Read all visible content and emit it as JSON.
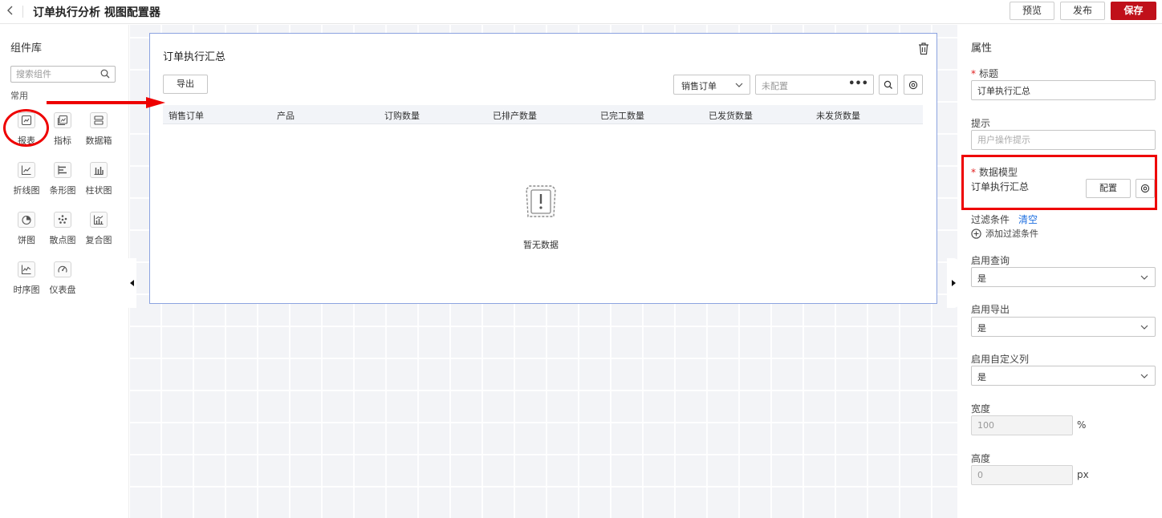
{
  "header": {
    "back_icon": "chevron-left-icon",
    "title": "订单执行分析 视图配置器",
    "buttons": {
      "preview": "预览",
      "publish": "发布",
      "save": "保存"
    },
    "colors": {
      "save_bg": "#c0101a"
    }
  },
  "library": {
    "title": "组件库",
    "search_placeholder": "搜索组件",
    "group_label": "常用",
    "components": [
      {
        "label": "报表",
        "icon": "report-icon"
      },
      {
        "label": "指标",
        "icon": "indicator-icon"
      },
      {
        "label": "数据箱",
        "icon": "databox-icon"
      },
      {
        "label": "折线图",
        "icon": "line-chart-icon"
      },
      {
        "label": "条形图",
        "icon": "bar-horizontal-icon"
      },
      {
        "label": "柱状图",
        "icon": "column-chart-icon"
      },
      {
        "label": "饼图",
        "icon": "pie-chart-icon"
      },
      {
        "label": "散点图",
        "icon": "scatter-icon"
      },
      {
        "label": "复合图",
        "icon": "combo-chart-icon"
      },
      {
        "label": "时序图",
        "icon": "timeseries-icon"
      },
      {
        "label": "仪表盘",
        "icon": "gauge-icon"
      }
    ]
  },
  "widget": {
    "title": "订单执行汇总",
    "export_label": "导出",
    "order_select": "销售订单",
    "config_placeholder": "未配置",
    "columns": [
      "销售订单",
      "产品",
      "订购数量",
      "已排产数量",
      "已完工数量",
      "已发货数量",
      "未发货数量"
    ],
    "empty_text": "暂无数据"
  },
  "props": {
    "title": "属性",
    "title_label": "标题",
    "title_value": "订单执行汇总",
    "hint_label": "提示",
    "hint_placeholder": "用户操作提示",
    "data_model_label": "数据模型",
    "data_model_value": "订单执行汇总",
    "config_label": "配置",
    "filter_label": "过滤条件",
    "clear_label": "清空",
    "add_filter_label": "添加过滤条件",
    "enable_query_label": "启用查询",
    "enable_query_value": "是",
    "enable_export_label": "启用导出",
    "enable_export_value": "是",
    "enable_custom_cols_label": "启用自定义列",
    "enable_custom_cols_value": "是",
    "width_label": "宽度",
    "width_value": "100",
    "width_unit": "%",
    "height_label": "高度",
    "height_value": "0",
    "height_unit": "px",
    "colors": {
      "link": "#1f6fe0",
      "required": "#e02020",
      "annotation": "#e00000"
    }
  }
}
